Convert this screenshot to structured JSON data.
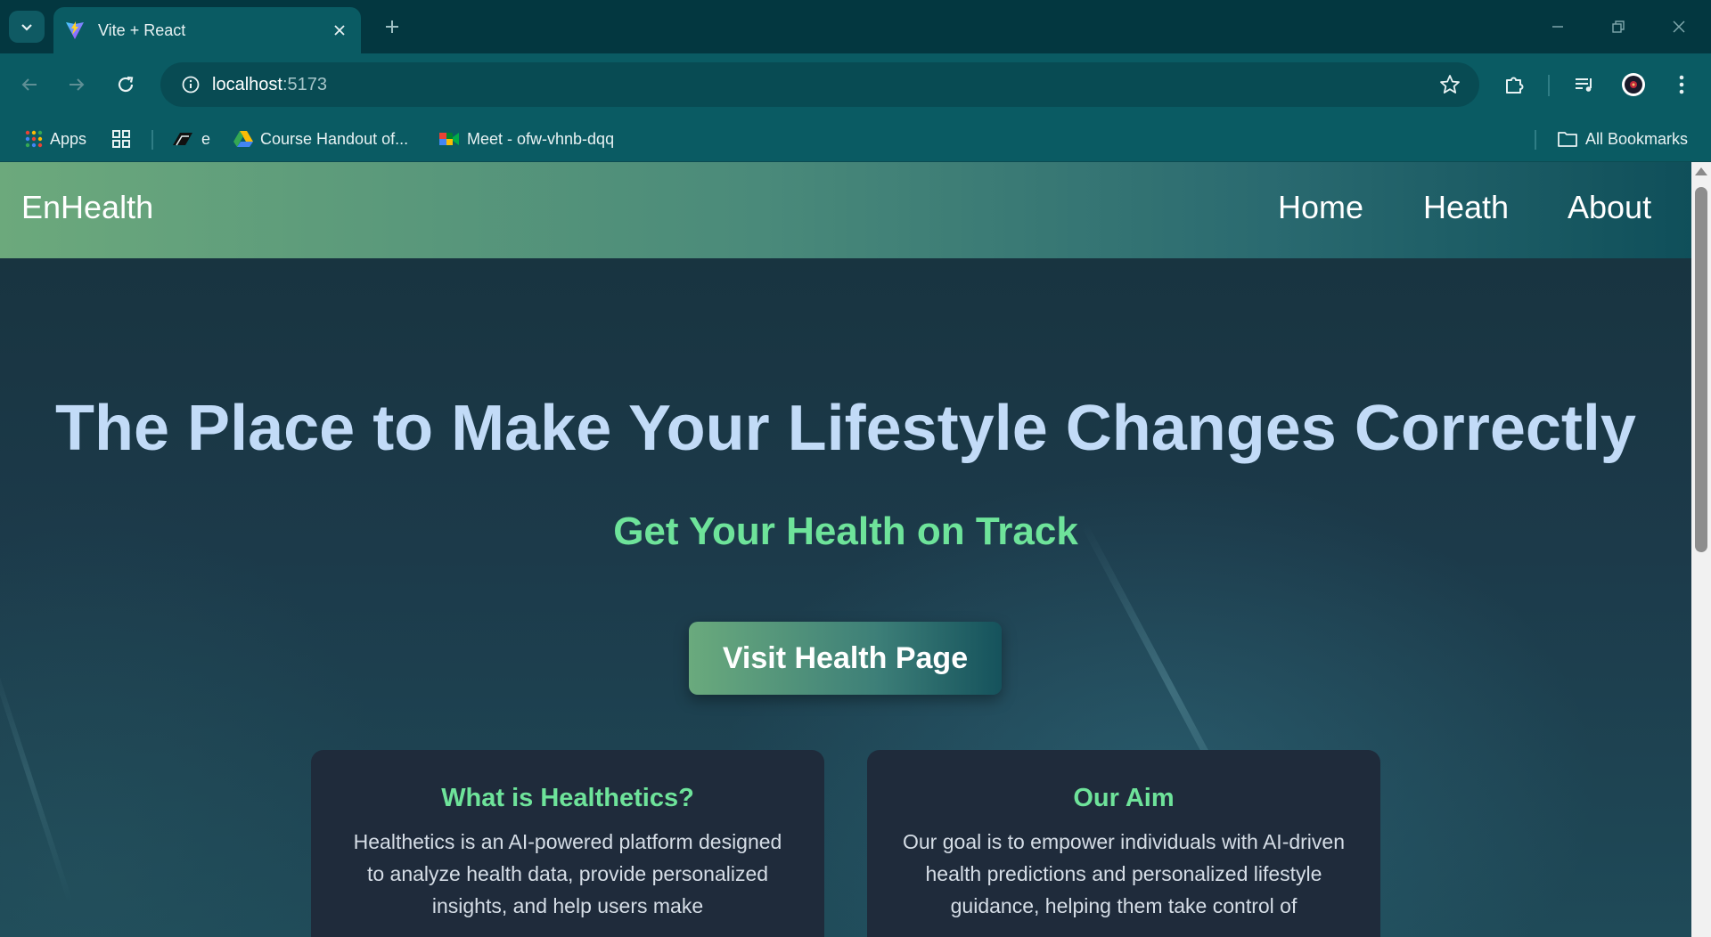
{
  "browser": {
    "tab_title": "Vite + React",
    "url_host": "localhost",
    "url_port": ":5173",
    "bookmarks": [
      {
        "label": "Apps",
        "icon": "apps-grid-icon"
      },
      {
        "label": "",
        "icon": "grid-icon"
      },
      {
        "label": "e",
        "icon": "brand-logo-icon"
      },
      {
        "label": "Course Handout of...",
        "icon": "google-drive-icon"
      },
      {
        "label": "Meet - ofw-vhnb-dqq",
        "icon": "google-meet-icon"
      }
    ],
    "all_bookmarks": "All Bookmarks"
  },
  "site": {
    "brand": "EnHealth",
    "nav": [
      "Home",
      "Heath",
      "About"
    ],
    "hero_title": "The Place to Make Your Lifestyle Changes Correctly",
    "hero_subtitle": "Get Your Health on Track",
    "cta_label": "Visit Health Page",
    "cards": [
      {
        "title": "What is Healthetics?",
        "text": "Healthetics is an AI-powered platform designed to analyze health data, provide personalized insights, and help users make"
      },
      {
        "title": "Our Aim",
        "text": "Our goal is to empower individuals with AI-driven health predictions and personalized lifestyle guidance, helping them take control of"
      }
    ]
  },
  "colors": {
    "title_blue": "#c2dbf7",
    "accent_green": "#6ee39a",
    "card_bg": "#1f2b3b",
    "chrome_teal": "#0a5b63"
  }
}
